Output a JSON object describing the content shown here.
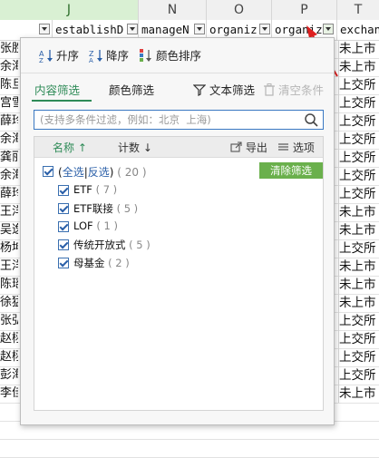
{
  "sheet": {
    "columns": [
      {
        "letter": "J",
        "active": true
      },
      {
        "letter": "N",
        "active": false
      },
      {
        "letter": "O",
        "active": false
      },
      {
        "letter": "P",
        "active": false
      },
      {
        "letter": "T",
        "active": false
      }
    ],
    "header_cells": [
      "establishD",
      "manageN",
      "organiz",
      "organiz",
      "exchan"
    ],
    "left_chars": [
      "张胜",
      "余海",
      "陈旦",
      "宫雪",
      "薛玲",
      "余海",
      "龚丽",
      "余海",
      "薛玲",
      "王洋",
      "吴逸",
      "杨坤",
      "王洋",
      "陈瑶",
      "徐猛",
      "张弘",
      "赵栩",
      "赵栩",
      "彭海",
      "李佳"
    ],
    "right_cells": [
      "未上市",
      "未上市",
      "上交所",
      "上交所",
      "上交所",
      "上交所",
      "上交所",
      "上交所",
      "上交所",
      "未上市",
      "未上市",
      "上交所",
      "未上市",
      "未上市",
      "未上市",
      "上交所",
      "上交所",
      "上交所",
      "上交所",
      "未上市"
    ]
  },
  "panel": {
    "sort_asc": "升序",
    "sort_desc": "降序",
    "sort_color": "颜色排序",
    "tab_content": "内容筛选",
    "tab_color": "颜色筛选",
    "text_filter": "文本筛选",
    "clear_conditions": "清空条件",
    "search_placeholder": "(支持多条件过滤，例如：北京  上海)",
    "col_name": "名称",
    "col_count": "计数",
    "export": "导出",
    "options": "选项",
    "select_all": "全选",
    "separator": "|",
    "invert": "反选",
    "all_count": "( 20 )",
    "clear_filter": "清除筛选",
    "items": [
      {
        "label": "ETF",
        "count": "( 7 )"
      },
      {
        "label": "ETF联接",
        "count": "( 5 )"
      },
      {
        "label": "LOF",
        "count": "( 1 )"
      },
      {
        "label": "传统开放式",
        "count": "( 5 )"
      },
      {
        "label": "母基金",
        "count": "( 2 )"
      }
    ]
  },
  "colors": {
    "accent": "#2e8b57",
    "clear_btn": "#6ab04c",
    "link": "#2a5fa8",
    "arrow": "#e02020"
  }
}
